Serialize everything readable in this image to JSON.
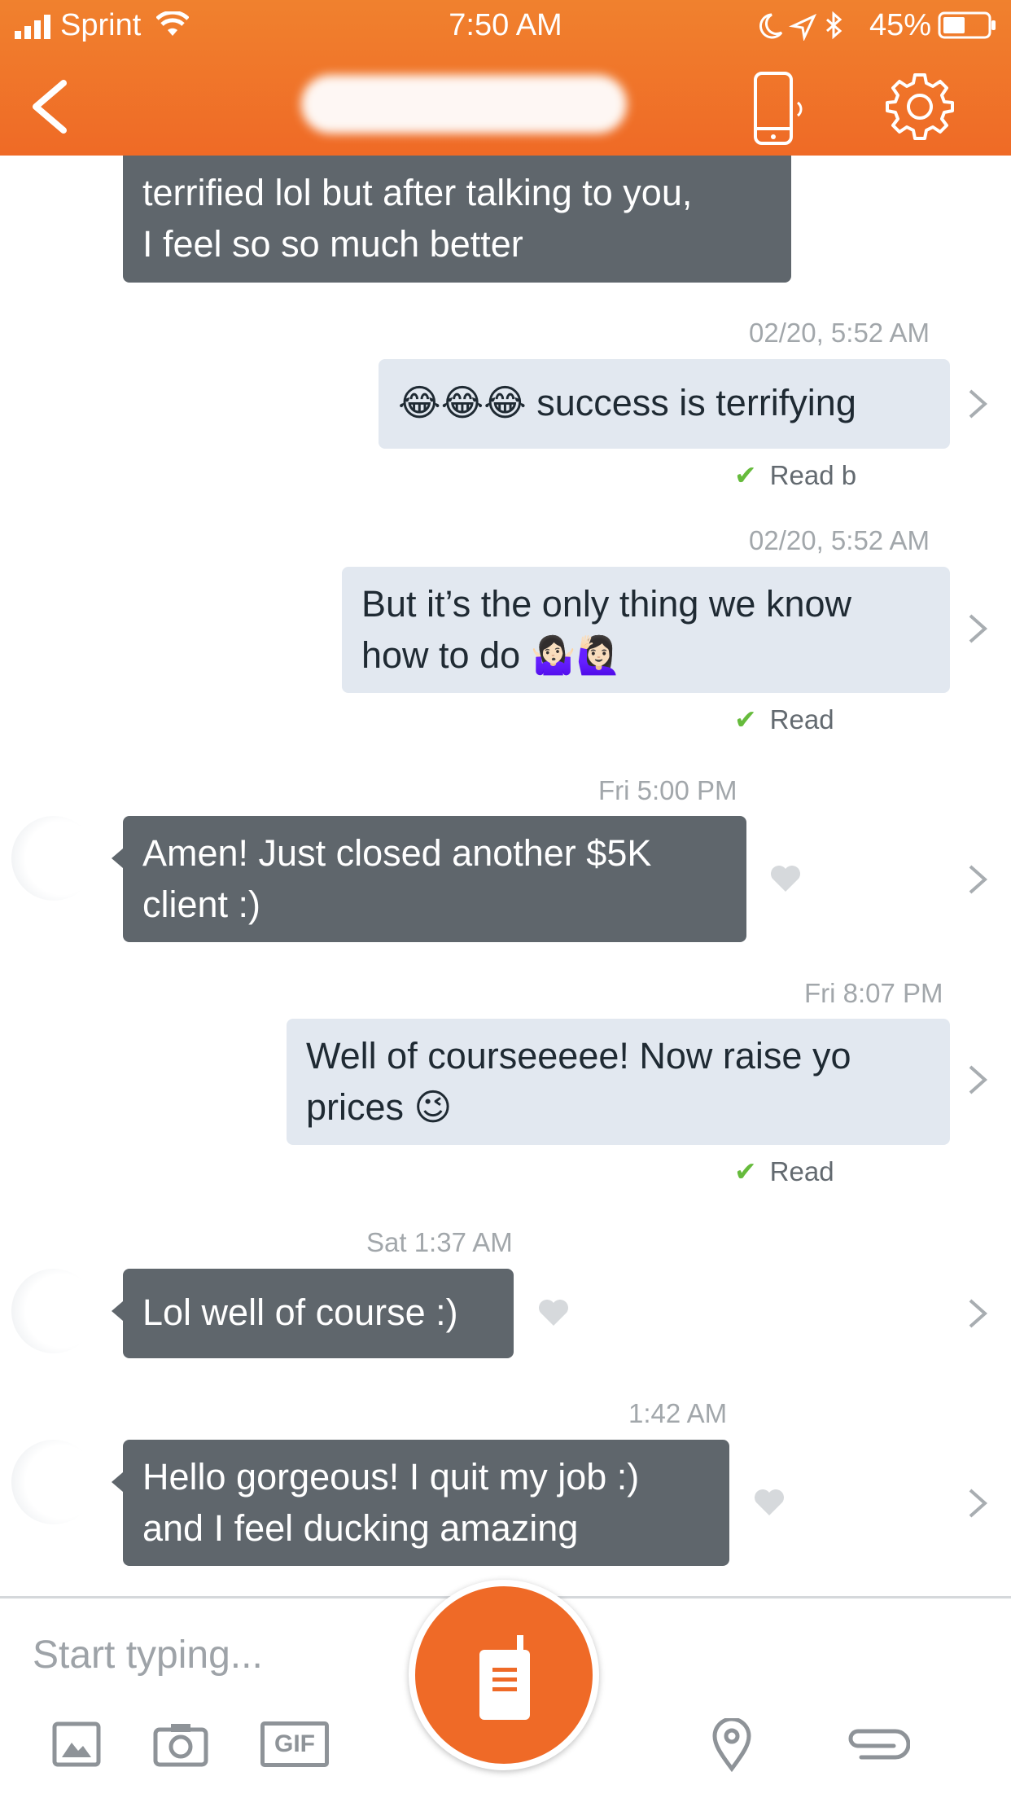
{
  "status_bar": {
    "carrier": "Sprint",
    "time": "7:50 AM",
    "battery": "45%"
  },
  "header": {
    "back_icon": "chevron-left-icon",
    "call_icon": "phone-ring-icon",
    "settings_icon": "gear-icon"
  },
  "messages": [
    {
      "direction": "in",
      "text_line1": "terrified lol but after talking to you,",
      "text_line2": "I feel so so much better"
    },
    {
      "direction": "out",
      "timestamp": "02/20, 5:52 AM",
      "text": "😂😂😂 success is terrifying",
      "read": "Read b"
    },
    {
      "direction": "out",
      "timestamp": "02/20, 5:52 AM",
      "text_line1": "But it’s the only thing we know",
      "text_line2": "how to do 🤷🏻‍♀️🙋🏻‍♀️",
      "read": "Read"
    },
    {
      "direction": "in",
      "timestamp": "Fri 5:00 PM",
      "text_line1": "Amen! Just closed another $5K",
      "text_line2": "client :)"
    },
    {
      "direction": "out",
      "timestamp": "Fri 8:07 PM",
      "text_line1": "Well of courseeeee! Now raise yo",
      "text_line2": "prices 😉",
      "read": "Read"
    },
    {
      "direction": "in",
      "timestamp": "Sat 1:37 AM",
      "text": "Lol well of course :)"
    },
    {
      "direction": "in",
      "timestamp": "1:42 AM",
      "text_line1": "Hello gorgeous! I quit my job :)",
      "text_line2": "and I feel ducking amazing"
    }
  ],
  "composer": {
    "placeholder": "Start typing...",
    "gif_label": "GIF"
  },
  "colors": {
    "accent_orange": "#ef6a26",
    "incoming_bubble": "#5f666c",
    "outgoing_bubble": "#e2e8f0",
    "read_check": "#66bb3c"
  }
}
